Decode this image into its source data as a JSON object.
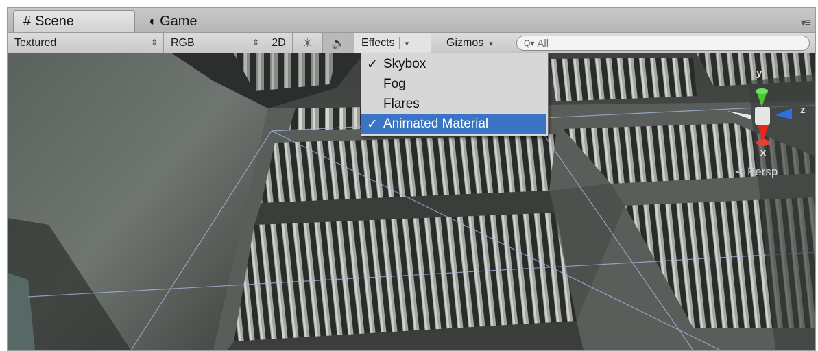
{
  "tabs": [
    {
      "label": "Scene",
      "icon": "hash-icon",
      "glyph": "#",
      "active": true
    },
    {
      "label": "Game",
      "icon": "pacman-icon",
      "glyph": "◖",
      "active": false
    }
  ],
  "toolbar": {
    "draw_mode": "Textured",
    "render_mode": "RGB",
    "mode_2d": "2D",
    "lighting_glyph": "☀",
    "audio_glyph": "🔊",
    "effects_label": "Effects",
    "gizmos_label": "Gizmos",
    "search_placeholder": "All"
  },
  "effects_menu": {
    "items": [
      {
        "label": "Skybox",
        "checked": true,
        "selected": false
      },
      {
        "label": "Fog",
        "checked": false,
        "selected": false
      },
      {
        "label": "Flares",
        "checked": false,
        "selected": false
      },
      {
        "label": "Animated Material",
        "checked": true,
        "selected": true
      }
    ]
  },
  "gizmo": {
    "view_label": "Persp",
    "axes": {
      "y": "y",
      "z": "z",
      "x": "x"
    }
  },
  "colors": {
    "selection": "#3b74c7",
    "axis_x": "#e0281e",
    "axis_y": "#48c832",
    "axis_z": "#2f6fe0"
  }
}
